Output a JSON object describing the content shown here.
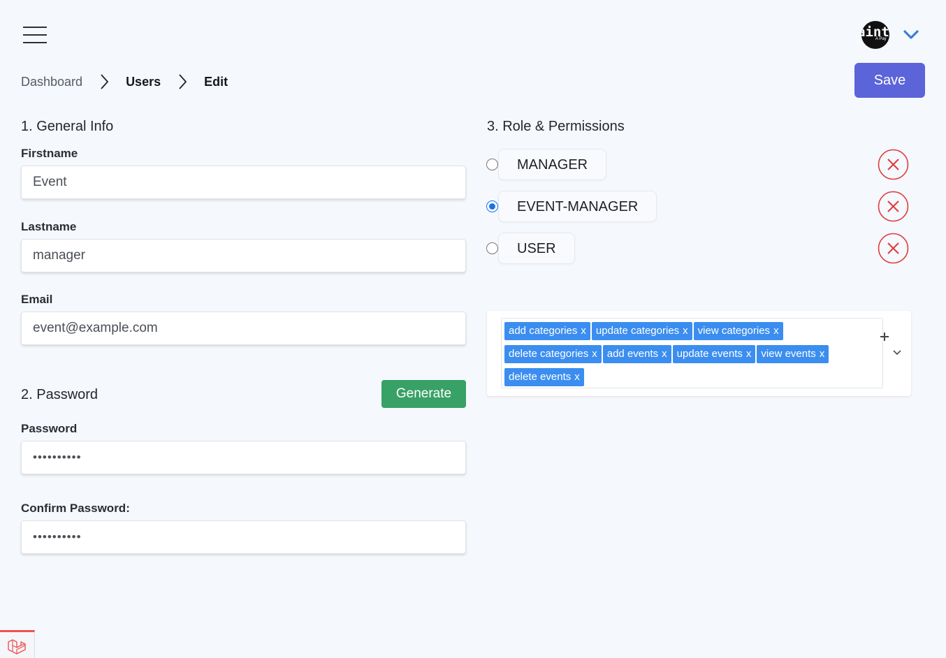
{
  "header": {
    "menu_icon": "hamburger-menu-icon",
    "avatar_text": "aint",
    "avatar_subtext": "A Pay",
    "dropdown_icon": "chevron-down-icon",
    "accent_color": "#3b7fd1"
  },
  "breadcrumb": {
    "items": [
      "Dashboard",
      "Users",
      "Edit"
    ],
    "separator_icon": "chevron-right-icon"
  },
  "actions": {
    "save_label": "Save",
    "save_color": "#5b64d8"
  },
  "general_info": {
    "title": "1. General Info",
    "firstname_label": "Firstname",
    "firstname_value": "Event",
    "lastname_label": "Lastname",
    "lastname_value": "manager",
    "email_label": "Email",
    "email_value": "event@example.com"
  },
  "password": {
    "title": "2. Password",
    "generate_label": "Generate",
    "generate_color": "#38a165",
    "password_label": "Password",
    "password_value": "••••••••••",
    "confirm_label": "Confirm Password:",
    "confirm_value": "••••••••••"
  },
  "roles": {
    "title": "3. Role & Permissions",
    "items": [
      {
        "label": "MANAGER",
        "selected": false
      },
      {
        "label": "EVENT-MANAGER",
        "selected": true
      },
      {
        "label": "USER",
        "selected": false
      }
    ],
    "remove_icon": "circle-x-icon",
    "remove_color": "#e03c3c"
  },
  "permissions": {
    "tag_remove": "x",
    "tags": [
      "add categories",
      "update categories",
      "view categories",
      "delete categories",
      "add events",
      "update events",
      "view events",
      "delete events"
    ],
    "tag_color": "#3b8ef0",
    "add_icon": "plus-icon",
    "dropdown_icon": "chevron-down-icon"
  },
  "footer": {
    "debug_icon": "laravel-logo-icon"
  }
}
